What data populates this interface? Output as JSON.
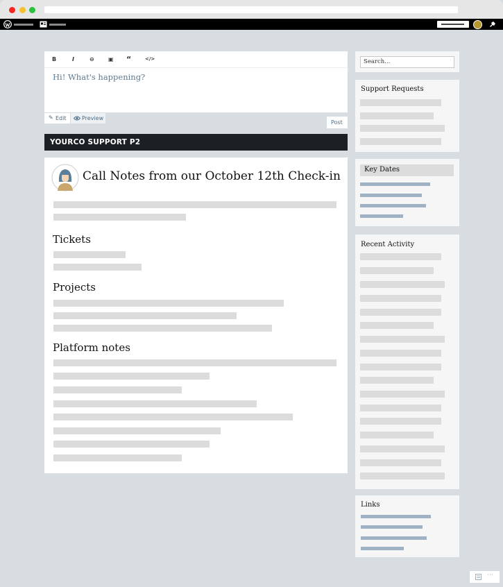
{
  "toolbar": {
    "buttons": [
      {
        "label": "B",
        "name": "bold-button"
      },
      {
        "label": "I",
        "name": "italic-button"
      },
      {
        "label": "⊖",
        "name": "link-button"
      },
      {
        "label": "▣",
        "name": "image-button"
      },
      {
        "label": "“",
        "name": "quote-button"
      },
      {
        "label": "</>",
        "name": "code-button"
      }
    ]
  },
  "composer": {
    "placeholder": "Hi! What's happening?",
    "edit_label": "Edit",
    "preview_label": "Preview",
    "post_label": "Post"
  },
  "site": {
    "title": "YOURCO SUPPORT P2"
  },
  "post": {
    "title": "Call Notes from our October 12th Check-in",
    "sections": [
      "Tickets",
      "Projects",
      "Platform notes"
    ]
  },
  "sidebar": {
    "search_placeholder": "Search...",
    "widgets": [
      "Support Requests",
      "Key Dates",
      "Recent Activity",
      "Links"
    ]
  },
  "colors": {
    "site_header": "#1b2024",
    "link_bar": "#9eb2c3",
    "placeholder_bar": "#dcdcdc",
    "page_bg": "#d7dde0"
  }
}
